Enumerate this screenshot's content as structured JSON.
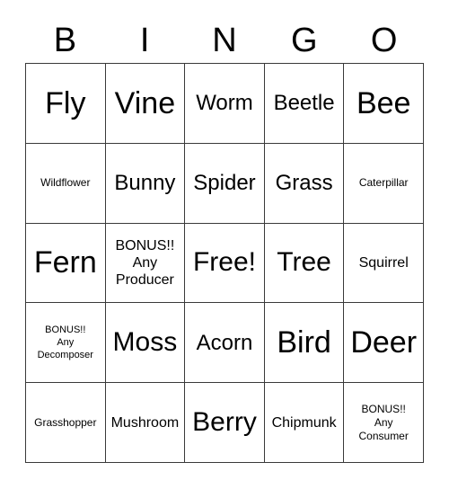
{
  "card": {
    "header_letters": [
      "B",
      "I",
      "N",
      "G",
      "O"
    ],
    "columns": 5,
    "rows": 5,
    "colors": {
      "background": "#ffffff",
      "grid_line": "#3a3a3a",
      "text": "#000000"
    },
    "cells": [
      {
        "text": "Fly",
        "size": "xl"
      },
      {
        "text": "Vine",
        "size": "xl"
      },
      {
        "text": "Worm",
        "size": "md"
      },
      {
        "text": "Beetle",
        "size": "md"
      },
      {
        "text": "Bee",
        "size": "xl"
      },
      {
        "text": "Wildflower",
        "size": "xs"
      },
      {
        "text": "Bunny",
        "size": "md"
      },
      {
        "text": "Spider",
        "size": "md"
      },
      {
        "text": "Grass",
        "size": "md"
      },
      {
        "text": "Caterpillar",
        "size": "xs"
      },
      {
        "text": "Fern",
        "size": "xl"
      },
      {
        "text": "BONUS!!\nAny\nProducer",
        "size": "sm"
      },
      {
        "text": "Free!",
        "size": "lg"
      },
      {
        "text": "Tree",
        "size": "lg"
      },
      {
        "text": "Squirrel",
        "size": "sm"
      },
      {
        "text": "BONUS!!\nAny\nDecomposer",
        "size": "xxs"
      },
      {
        "text": "Moss",
        "size": "lg"
      },
      {
        "text": "Acorn",
        "size": "md"
      },
      {
        "text": "Bird",
        "size": "xl"
      },
      {
        "text": "Deer",
        "size": "xl"
      },
      {
        "text": "Grasshopper",
        "size": "xs"
      },
      {
        "text": "Mushroom",
        "size": "sm"
      },
      {
        "text": "Berry",
        "size": "lg"
      },
      {
        "text": "Chipmunk",
        "size": "sm"
      },
      {
        "text": "BONUS!!\nAny\nConsumer",
        "size": "xs"
      }
    ]
  }
}
